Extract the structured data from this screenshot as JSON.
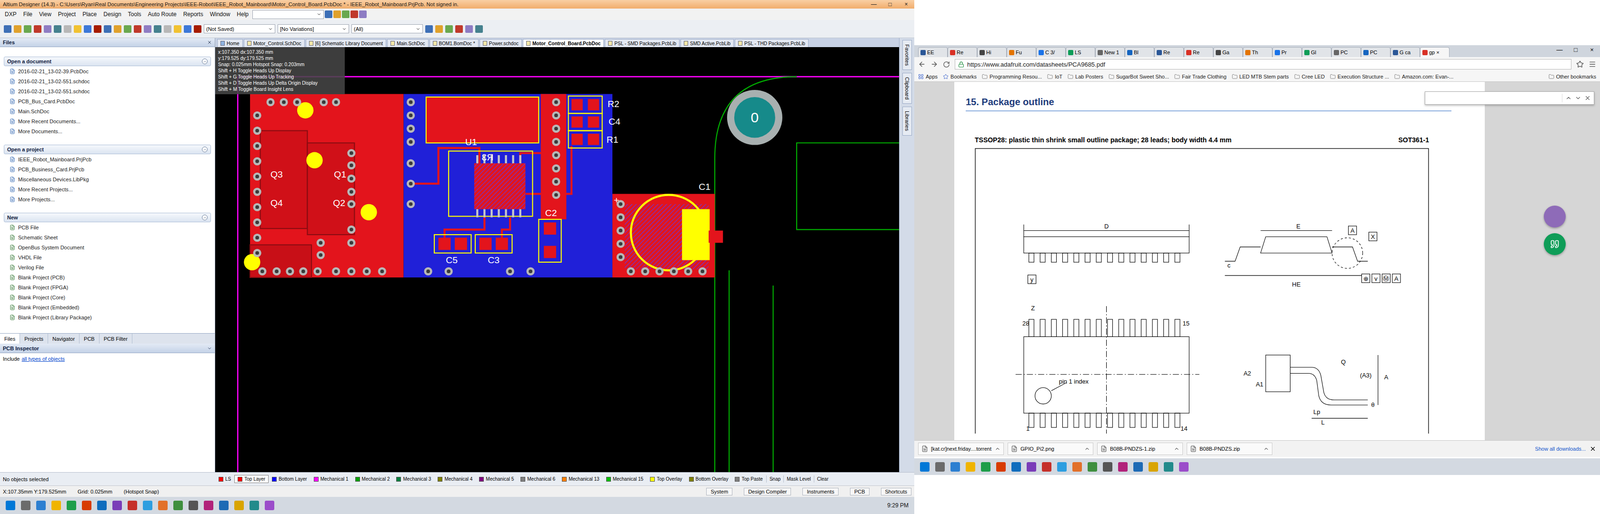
{
  "altium": {
    "title": "Altium Designer (14.3) - C:\\Users\\Ryan\\Real Documents\\Engineering Projects\\IEEE-Robot\\IEEE_Robot_Mainboard\\Motor_Control_Board.PcbDoc * - IEEE_Robot_Mainboard.PrjPcb. Not signed in.",
    "window_controls": [
      "—",
      "□",
      "×"
    ],
    "menu": [
      "DXP",
      "File",
      "View",
      "Project",
      "Place",
      "Design",
      "Tools",
      "Auto Route",
      "Reports",
      "Window",
      "Help"
    ],
    "toolbar_fields": [
      "(Not Saved)",
      "[No Variations]",
      "(All)"
    ],
    "doc_tabs": [
      {
        "label": "Home",
        "selected": false
      },
      {
        "label": "Motor_Control.SchDoc",
        "selected": false
      },
      {
        "label": "[6] Schematic Library Document",
        "selected": false
      },
      {
        "label": "Main.SchDoc",
        "selected": false
      },
      {
        "label": "BOM1.BomDoc *",
        "selected": false
      },
      {
        "label": "Power.schdoc",
        "selected": false
      },
      {
        "label": "Motor_Control_Board.PcbDoc",
        "selected": true
      },
      {
        "label": "PSL - SMD Packages.PcbLib",
        "selected": false
      },
      {
        "label": "SMD Active.PcbLib",
        "selected": false
      },
      {
        "label": "PSL - THD Packages.PcbLib",
        "selected": false
      }
    ],
    "files_panel": {
      "title": "Files",
      "sections": [
        {
          "title": "Open a document",
          "items": [
            "2016-02-21_13-02-39.PcbDoc",
            "2016-02-21_13-02-551.schdoc",
            "2016-02-21_13-02-551.schdoc",
            "PCB_Bus_Card.PcbDoc",
            "Main.SchDoc",
            "More Recent Documents...",
            "More Documents..."
          ]
        },
        {
          "title": "Open a project",
          "items": [
            "IEEE_Robot_Mainboard.PrjPcb",
            "PCB_Business_Card.PrjPcb",
            "Miscellaneous Devices.LibPkg",
            "More Recent Projects...",
            "More Projects..."
          ]
        },
        {
          "title": "New",
          "items": [
            "PCB File",
            "Schematic Sheet",
            "OpenBus System Document",
            "VHDL File",
            "Verilog File",
            "Blank Project (PCB)",
            "Blank Project (FPGA)",
            "Blank Project (Core)",
            "Blank Project (Embedded)",
            "Blank Project (Library Package)"
          ]
        }
      ],
      "tabs": [
        {
          "label": "Files",
          "selected": true
        },
        {
          "label": "Projects",
          "selected": false
        },
        {
          "label": "Navigator",
          "selected": false
        },
        {
          "label": "PCB",
          "selected": false
        },
        {
          "label": "PCB Filter",
          "selected": false
        }
      ]
    },
    "inspector": {
      "title": "PCB Inspector",
      "prefix": "Include",
      "link": "all types of objects"
    },
    "side_panels": [
      "Favorites",
      "Clipboard",
      "Libraries"
    ],
    "hud": [
      "x:107.350  dx:107.350 mm",
      "y:179.525  dy:179.525 mm",
      "Snap: 0.025mm Hotspot Snap: 0.203mm",
      "Shift + H  Toggle Heads Up Display",
      "Shift + G  Toggle Heads Up Tracking",
      "Shift + D  Toggle Heads Up Delta Origin Display",
      "Shift + M  Toggle Board Insight Lens"
    ],
    "pcb": {
      "labels": [
        {
          "text": "R2",
          "mirrored": false
        },
        {
          "text": "C4",
          "mirrored": false
        },
        {
          "text": "R1",
          "mirrored": false
        },
        {
          "text": "U1",
          "mirrored": false
        },
        {
          "text": "R3",
          "mirrored": true
        },
        {
          "text": "Q3",
          "mirrored": false
        },
        {
          "text": "Q1",
          "mirrored": false
        },
        {
          "text": "Q4",
          "mirrored": false
        },
        {
          "text": "Q2",
          "mirrored": false
        },
        {
          "text": "C2",
          "mirrored": false
        },
        {
          "text": "C5",
          "mirrored": false
        },
        {
          "text": "C3",
          "mirrored": false
        },
        {
          "text": "C1",
          "mirrored": false
        },
        {
          "text": "+",
          "mirrored": false
        }
      ],
      "mount_hole": "0"
    },
    "selection": "No objects selected",
    "layers": [
      {
        "label": "LS",
        "color": "#ff0000",
        "selected": false
      },
      {
        "label": "Top Layer",
        "color": "#ff0000",
        "selected": true
      },
      {
        "label": "Bottom Layer",
        "color": "#0000ff",
        "selected": false
      },
      {
        "label": "Mechanical 1",
        "color": "#ff00ff",
        "selected": false
      },
      {
        "label": "Mechanical 2",
        "color": "#00a000",
        "selected": false
      },
      {
        "label": "Mechanical 3",
        "color": "#008040",
        "selected": false
      },
      {
        "label": "Mechanical 4",
        "color": "#808000",
        "selected": false
      },
      {
        "label": "Mechanical 5",
        "color": "#800080",
        "selected": false
      },
      {
        "label": "Mechanical 6",
        "color": "#808080",
        "selected": false
      },
      {
        "label": "Mechanical 13",
        "color": "#ff8000",
        "selected": false
      },
      {
        "label": "Mechanical 15",
        "color": "#00c000",
        "selected": false
      },
      {
        "label": "Top Overlay",
        "color": "#ffff00",
        "selected": false
      },
      {
        "label": "Bottom Overlay",
        "color": "#808000",
        "selected": false
      },
      {
        "label": "Top Paste",
        "color": "#808080",
        "selected": false
      }
    ],
    "layer_actions": [
      "Snap",
      "Mask Level",
      "Clear"
    ],
    "status": {
      "coords": "X:107.35mm Y:179.525mm",
      "grid": "Grid: 0.025mm",
      "snap": "(Hotspot Snap)",
      "panels": [
        "System",
        "Design Compiler",
        "Instruments",
        "PCB",
        "Shortcuts"
      ]
    },
    "clock": "9:29 PM"
  },
  "chrome": {
    "tabs": [
      {
        "label": "EE",
        "selected": false
      },
      {
        "label": "Re",
        "selected": false
      },
      {
        "label": "Hi",
        "selected": false
      },
      {
        "label": "Fu",
        "selected": false
      },
      {
        "label": "C 3/",
        "selected": false
      },
      {
        "label": "LS",
        "selected": false
      },
      {
        "label": "New 1",
        "selected": false
      },
      {
        "label": "Bl",
        "selected": false
      },
      {
        "label": "Re",
        "selected": false
      },
      {
        "label": "Re",
        "selected": false
      },
      {
        "label": "Ga",
        "selected": false
      },
      {
        "label": "Th",
        "selected": false
      },
      {
        "label": "Pr",
        "selected": false
      },
      {
        "label": "Gl",
        "selected": false
      },
      {
        "label": "PC",
        "selected": false
      },
      {
        "label": "PC",
        "selected": false
      },
      {
        "label": "G ca",
        "selected": false
      },
      {
        "label": "gp",
        "selected": true
      }
    ],
    "tab_close": "×",
    "window_controls": [
      "—",
      "□",
      "×"
    ],
    "url": "https://www.adafruit.com/datasheets/PCA9685.pdf",
    "bookmarks": [
      "Apps",
      "Bookmarks",
      "Programming Resou...",
      "IoT",
      "Lab Posters",
      "SugarBot Sweet Sho...",
      "Fair Trade Clothing",
      "LED MTB Stem parts",
      "Cree LED",
      "Execution Structure ...",
      "Amazon.com: Evan-..."
    ],
    "other_bookmarks": "Other bookmarks",
    "pdf": {
      "heading": "15. Package outline",
      "subtitle": "TSSOP28: plastic thin shrink small outline package; 28 leads; body width 4.4 mm",
      "code": "SOT361-1",
      "labels": [
        {
          "text": "D",
          "kind": "plain"
        },
        {
          "text": "E",
          "kind": "plain"
        },
        {
          "text": "A",
          "kind": "boxed"
        },
        {
          "text": "X",
          "kind": "boxed"
        },
        {
          "text": "y",
          "kind": "boxed"
        },
        {
          "text": "c",
          "kind": "plain"
        },
        {
          "text": "HE",
          "kind": "plain"
        },
        {
          "text": "⊕",
          "kind": "boxed"
        },
        {
          "text": "v",
          "kind": "boxed"
        },
        {
          "text": "Ⓜ",
          "kind": "boxed"
        },
        {
          "text": "A",
          "kind": "boxed"
        },
        {
          "text": "Z",
          "kind": "plain"
        },
        {
          "text": "28",
          "kind": "plain"
        },
        {
          "text": "15",
          "kind": "plain"
        },
        {
          "text": "1",
          "kind": "plain"
        },
        {
          "text": "14",
          "kind": "plain"
        },
        {
          "text": "pin 1 index",
          "kind": "plain"
        },
        {
          "text": "A2",
          "kind": "plain"
        },
        {
          "text": "A1",
          "kind": "plain"
        },
        {
          "text": "Q",
          "kind": "plain"
        },
        {
          "text": "(A3)",
          "kind": "plain"
        },
        {
          "text": "A",
          "kind": "plain"
        },
        {
          "text": "Lp",
          "kind": "plain"
        },
        {
          "text": "L",
          "kind": "plain"
        },
        {
          "text": "θ",
          "kind": "plain"
        }
      ]
    },
    "downloads": [
      "[kat.cr]next.friday....torrent",
      "GPIO_Pi2.png",
      "B08B-PNDZS-1.zip",
      "B08B-PNDZS.zip"
    ],
    "show_all": "Show all downloads..."
  }
}
